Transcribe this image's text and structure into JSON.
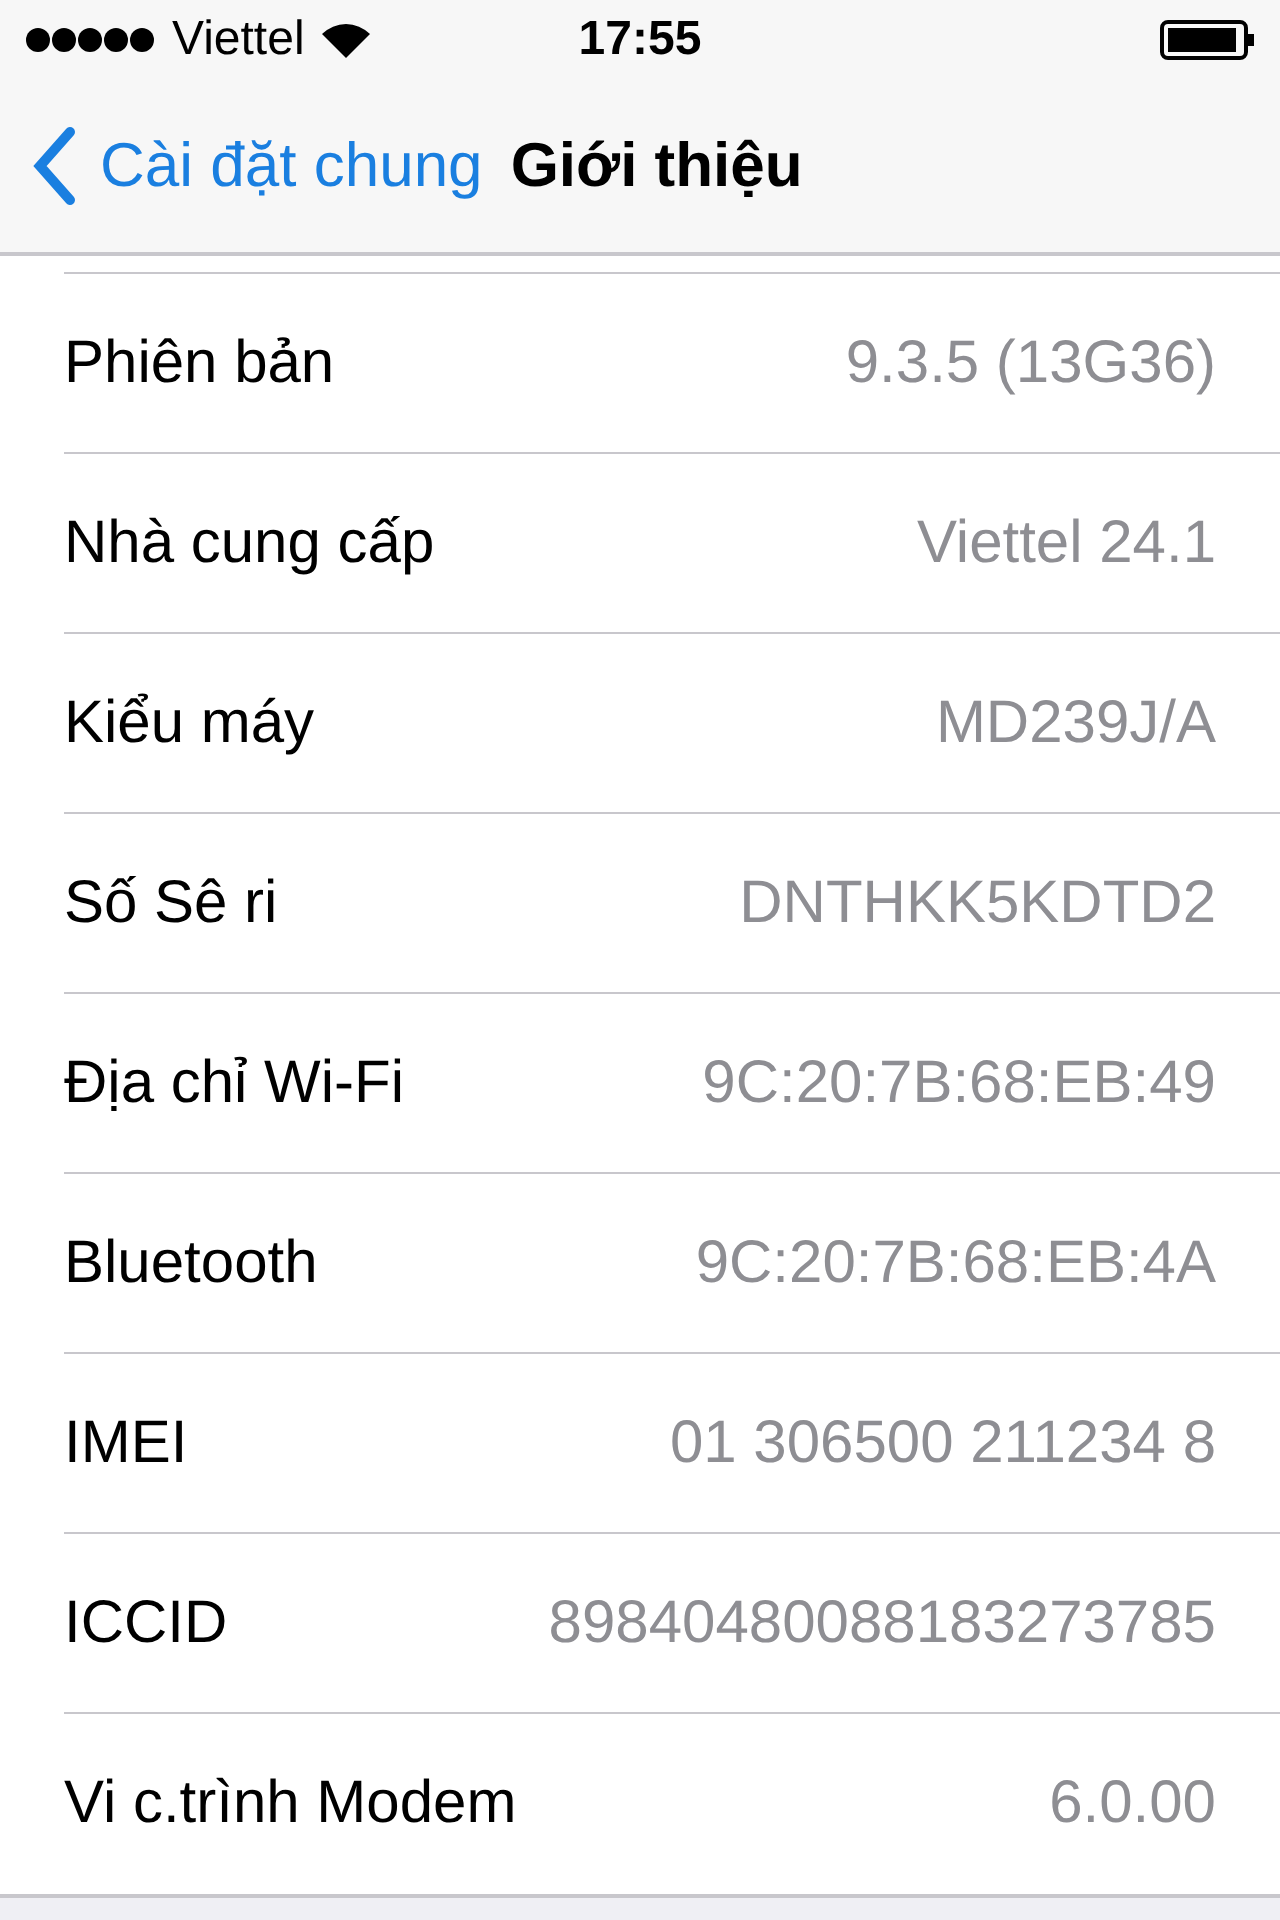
{
  "status_bar": {
    "carrier": "Viettel",
    "time": "17:55"
  },
  "nav": {
    "back": "Cài đặt chung",
    "title": "Giới thiệu"
  },
  "rows": [
    {
      "label": "Phiên bản",
      "value": "9.3.5 (13G36)"
    },
    {
      "label": "Nhà cung cấp",
      "value": "Viettel 24.1"
    },
    {
      "label": "Kiểu máy",
      "value": "MD239J/A"
    },
    {
      "label": "Số Sê ri",
      "value": "DNTHKK5KDTD2"
    },
    {
      "label": "Địa chỉ Wi-Fi",
      "value": "9C:20:7B:68:EB:49"
    },
    {
      "label": "Bluetooth",
      "value": "9C:20:7B:68:EB:4A"
    },
    {
      "label": "IMEI",
      "value": "01 306500 211234 8"
    },
    {
      "label": "ICCID",
      "value": "89840480088183273785"
    },
    {
      "label": "Vi c.trình Modem",
      "value": "6.0.00"
    }
  ]
}
